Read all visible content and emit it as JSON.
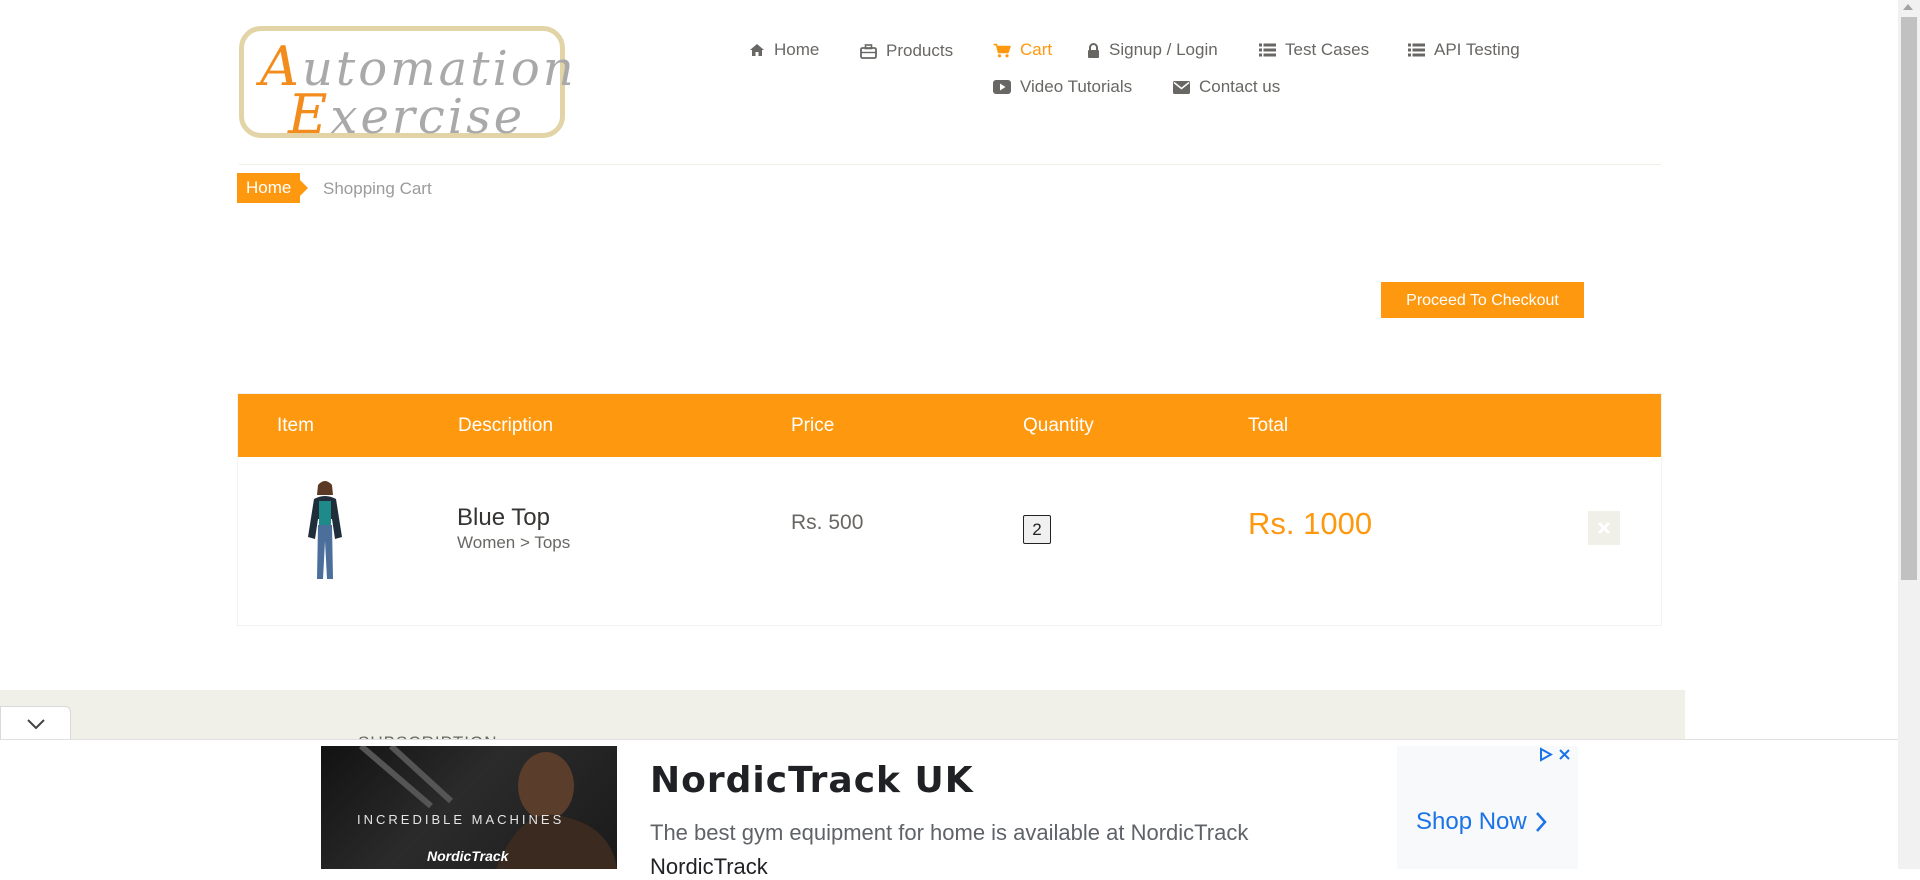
{
  "logo": {
    "line1_cap": "A",
    "line1_rest": "utomation",
    "line2_cap": "E",
    "line2_rest": "xercise"
  },
  "nav": {
    "items": [
      {
        "label": "Home",
        "icon": "home-icon"
      },
      {
        "label": "Products",
        "icon": "briefcase-icon"
      },
      {
        "label": "Cart",
        "icon": "cart-icon",
        "active": true
      },
      {
        "label": "Signup / Login",
        "icon": "lock-icon"
      },
      {
        "label": "Test Cases",
        "icon": "list-icon"
      },
      {
        "label": "API Testing",
        "icon": "list-icon"
      },
      {
        "label": "Video Tutorials",
        "icon": "youtube-play-icon"
      },
      {
        "label": "Contact us",
        "icon": "envelope-icon"
      }
    ]
  },
  "breadcrumb": {
    "home": "Home",
    "current": "Shopping Cart"
  },
  "checkout": {
    "label": "Proceed To Checkout"
  },
  "cart": {
    "headers": [
      "Item",
      "Description",
      "Price",
      "Quantity",
      "Total"
    ],
    "rows": [
      {
        "name": "Blue Top",
        "category": "Women > Tops",
        "price": "Rs. 500",
        "quantity": "2",
        "total": "Rs. 1000"
      }
    ]
  },
  "footer": {
    "subscription": "SUBSCRIPTION"
  },
  "ad": {
    "image_tagline": "INCREDIBLE MACHINES",
    "image_brand": "NordicTrack",
    "title": "NordicTrack UK",
    "description": "The best gym equipment for home is available at NordicTrack",
    "advertiser": "NordicTrack",
    "cta": "Shop Now"
  },
  "colors": {
    "accent": "#fe980f",
    "text": "#696763",
    "footer_bg": "#f0f0e9",
    "ad_link": "#1a73e8"
  }
}
